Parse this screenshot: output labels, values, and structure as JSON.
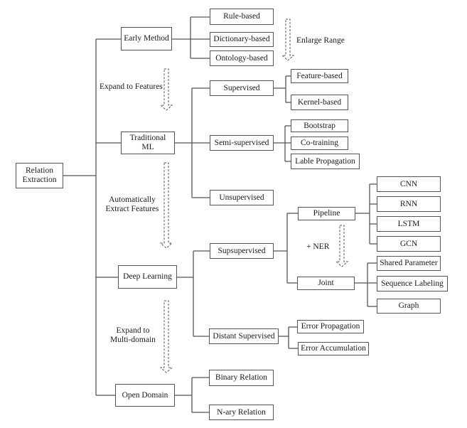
{
  "root": "Relation Extraction",
  "categories": {
    "early": {
      "label": "Early Method",
      "children": [
        "Rule-based",
        "Dictionary-based",
        "Ontology-based"
      ]
    },
    "traditional": {
      "label": "Traditional ML",
      "supervised": {
        "label": "Supervised",
        "children": [
          "Feature-based",
          "Kernel-based"
        ]
      },
      "semi": {
        "label": "Semi-supervised",
        "children": [
          "Bootstrap",
          "Co-training",
          "Lable Propagation"
        ]
      },
      "unsupervised": {
        "label": "Unsupervised"
      }
    },
    "deep": {
      "label": "Deep Learning",
      "supervised": {
        "label": "Supsupervised",
        "pipeline": {
          "label": "Pipeline",
          "children": [
            "CNN",
            "RNN",
            "LSTM",
            "GCN"
          ]
        },
        "joint": {
          "label": "Joint",
          "children": [
            "Shared Parameter",
            "Sequence Labeling",
            "Graph"
          ]
        }
      },
      "distant": {
        "label": "Distant Supervised",
        "children": [
          "Error Propagation",
          "Error Accumulation"
        ]
      }
    },
    "open": {
      "label": "Open Domain",
      "children": [
        "Binary Relation",
        "N-ary Relation"
      ]
    }
  },
  "annotations": {
    "enlarge_range": "Enlarge Range",
    "expand_features": "Expand to Features",
    "auto_extract": "Automatically Extract Features",
    "ner": "+ NER",
    "multi_domain": "Expand to Multi-domain"
  },
  "colors": {
    "line": "#555555",
    "text": "#1a1a1a"
  }
}
